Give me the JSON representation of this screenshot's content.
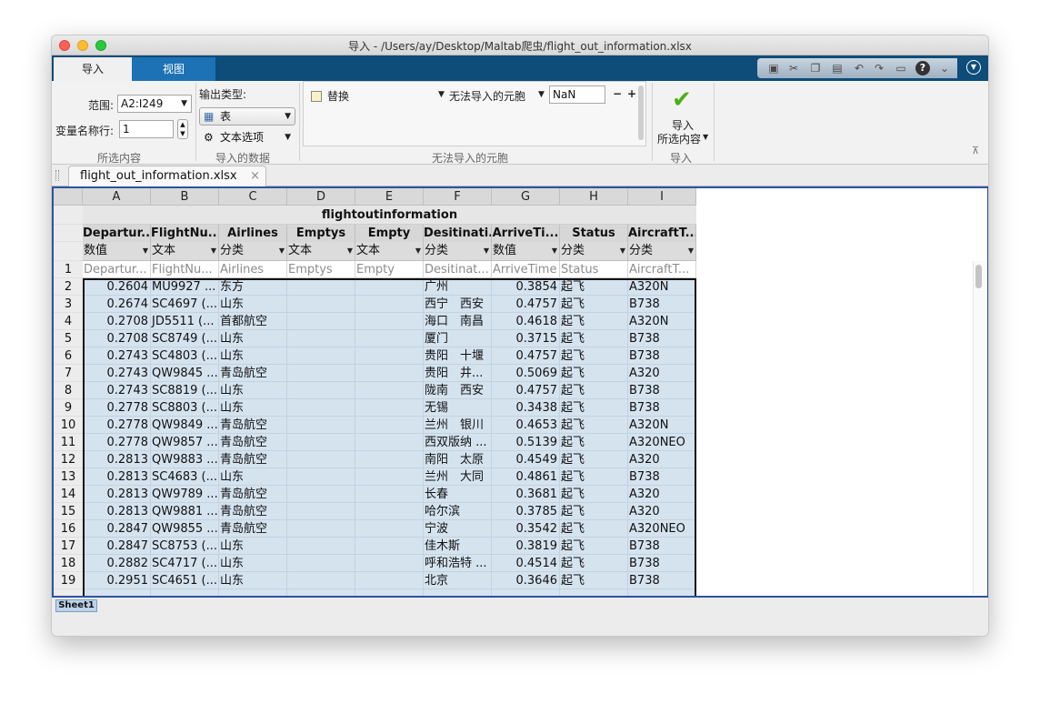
{
  "window": {
    "title": "导入 - /Users/ay/Desktop/Maltab爬虫/flight_out_information.xlsx"
  },
  "tabs": {
    "import": "导入",
    "view": "视图"
  },
  "ribbon": {
    "range_label": "范围:",
    "range_value": "A2:I249",
    "varrow_label": "变量名称行:",
    "varrow_value": "1",
    "section_selection": "所选内容",
    "output_type_label": "输出类型:",
    "output_type_value": "表",
    "text_options": "文本选项",
    "section_imported": "导入的数据",
    "rule_action": "替换",
    "rule_target": "无法导入的元胞",
    "rule_value": "NaN",
    "rule_minus": "−",
    "rule_plus": "+",
    "section_unimportable": "无法导入的元胞",
    "import_button_line1": "导入",
    "import_button_line2": "所选内容",
    "section_import": "导入"
  },
  "doc_tab": {
    "label": "flight_out_information.xlsx",
    "close": "×"
  },
  "sheet": {
    "table_title": "flightoutinformation",
    "columns": [
      {
        "letter": "A",
        "varname": "Departur...",
        "type": "数值",
        "orig": "Departur..."
      },
      {
        "letter": "B",
        "varname": "FlightNu...",
        "type": "文本",
        "orig": "FlightNu..."
      },
      {
        "letter": "C",
        "varname": "Airlines",
        "type": "分类",
        "orig": "Airlines"
      },
      {
        "letter": "D",
        "varname": "Emptys",
        "type": "文本",
        "orig": "Emptys"
      },
      {
        "letter": "E",
        "varname": "Empty",
        "type": "文本",
        "orig": "Empty"
      },
      {
        "letter": "F",
        "varname": "Desitinati...",
        "type": "分类",
        "orig": "Desitinat..."
      },
      {
        "letter": "G",
        "varname": "ArriveTi...",
        "type": "数值",
        "orig": "ArriveTime"
      },
      {
        "letter": "H",
        "varname": "Status",
        "type": "分类",
        "orig": "Status"
      },
      {
        "letter": "I",
        "varname": "AircraftT...",
        "type": "分类",
        "orig": "AircraftT..."
      }
    ],
    "rows": [
      {
        "n": "2",
        "cells": [
          "0.2604",
          "MU9927 ...",
          "东方",
          "",
          "",
          "广州",
          "0.3854",
          "起飞",
          "A320N"
        ]
      },
      {
        "n": "3",
        "cells": [
          "0.2674",
          "SC4697 (...",
          "山东",
          "",
          "",
          "西宁　西安",
          "0.4757",
          "起飞",
          "B738"
        ]
      },
      {
        "n": "4",
        "cells": [
          "0.2708",
          "JD5511 (...",
          "首都航空",
          "",
          "",
          "海口　南昌",
          "0.4618",
          "起飞",
          "A320N"
        ]
      },
      {
        "n": "5",
        "cells": [
          "0.2708",
          "SC8749 (...",
          "山东",
          "",
          "",
          "厦门",
          "0.3715",
          "起飞",
          "B738"
        ]
      },
      {
        "n": "6",
        "cells": [
          "0.2743",
          "SC4803 (...",
          "山东",
          "",
          "",
          "贵阳　十堰",
          "0.4757",
          "起飞",
          "B738"
        ]
      },
      {
        "n": "7",
        "cells": [
          "0.2743",
          "QW9845 ...",
          "青岛航空",
          "",
          "",
          "贵阳　井...",
          "0.5069",
          "起飞",
          "A320"
        ]
      },
      {
        "n": "8",
        "cells": [
          "0.2743",
          "SC8819 (...",
          "山东",
          "",
          "",
          "陇南　西安",
          "0.4757",
          "起飞",
          "B738"
        ]
      },
      {
        "n": "9",
        "cells": [
          "0.2778",
          "SC8803 (...",
          "山东",
          "",
          "",
          "无锡",
          "0.3438",
          "起飞",
          "B738"
        ]
      },
      {
        "n": "10",
        "cells": [
          "0.2778",
          "QW9849 ...",
          "青岛航空",
          "",
          "",
          "兰州　银川",
          "0.4653",
          "起飞",
          "A320N"
        ]
      },
      {
        "n": "11",
        "cells": [
          "0.2778",
          "QW9857 ...",
          "青岛航空",
          "",
          "",
          "西双版纳 ...",
          "0.5139",
          "起飞",
          "A320NEO"
        ]
      },
      {
        "n": "12",
        "cells": [
          "0.2813",
          "QW9883 ...",
          "青岛航空",
          "",
          "",
          "南阳　太原",
          "0.4549",
          "起飞",
          "A320"
        ]
      },
      {
        "n": "13",
        "cells": [
          "0.2813",
          "SC4683 (...",
          "山东",
          "",
          "",
          "兰州　大同",
          "0.4861",
          "起飞",
          "B738"
        ]
      },
      {
        "n": "14",
        "cells": [
          "0.2813",
          "QW9789 ...",
          "青岛航空",
          "",
          "",
          "长春",
          "0.3681",
          "起飞",
          "A320"
        ]
      },
      {
        "n": "15",
        "cells": [
          "0.2813",
          "QW9881 ...",
          "青岛航空",
          "",
          "",
          "哈尔滨",
          "0.3785",
          "起飞",
          "A320"
        ]
      },
      {
        "n": "16",
        "cells": [
          "0.2847",
          "QW9855 ...",
          "青岛航空",
          "",
          "",
          "宁波",
          "0.3542",
          "起飞",
          "A320NEO"
        ]
      },
      {
        "n": "17",
        "cells": [
          "0.2847",
          "SC8753 (...",
          "山东",
          "",
          "",
          "佳木斯",
          "0.3819",
          "起飞",
          "B738"
        ]
      },
      {
        "n": "18",
        "cells": [
          "0.2882",
          "SC4717 (...",
          "山东",
          "",
          "",
          "呼和浩特 ...",
          "0.4514",
          "起飞",
          "B738"
        ]
      },
      {
        "n": "19",
        "cells": [
          "0.2951",
          "SC4651 (...",
          "山东",
          "",
          "",
          "北京",
          "0.3646",
          "起飞",
          "B738"
        ]
      }
    ],
    "header_row_number": "1",
    "sheet_tab": "Sheet1"
  },
  "colors": {
    "titlebar_blue": "#0e4c7a",
    "selection_blue": "#d5e3ef",
    "frame_blue": "#2c53a3",
    "check_green": "#4caf1a"
  }
}
